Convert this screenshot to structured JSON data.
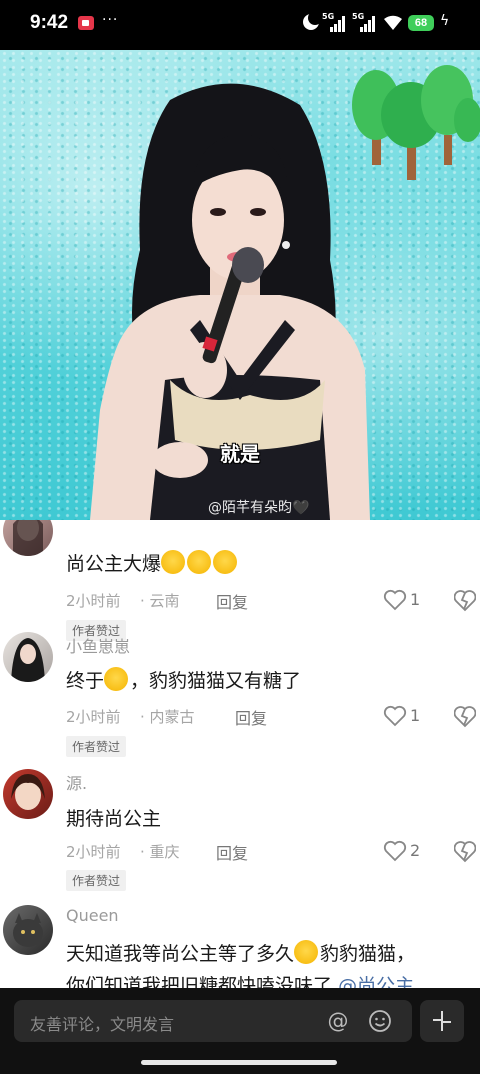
{
  "status_bar": {
    "time": "9:42",
    "dots": "···",
    "signal1_label": "5G",
    "signal2_label": "5G",
    "battery": "68"
  },
  "video": {
    "caption": "就是",
    "watermark": "@陌芊有朵昀🖤"
  },
  "comments": [
    {
      "username": "",
      "text": "尚公主大爆",
      "emoji": [
        "laugh",
        "laugh",
        "laugh"
      ],
      "time": "2小时前",
      "location": "云南",
      "reply": "回复",
      "likes": "1",
      "author_liked": "作者赞过"
    },
    {
      "username": "小鱼崽崽",
      "text_pre": "终于",
      "emoji": [
        "cry"
      ],
      "text_post": "，豹豹猫猫又有糖了",
      "time": "2小时前",
      "location": "内蒙古",
      "reply": "回复",
      "likes": "1",
      "author_liked": "作者赞过"
    },
    {
      "username": "源.",
      "text": "期待尚公主",
      "time": "2小时前",
      "location": "重庆",
      "reply": "回复",
      "likes": "2",
      "author_liked": "作者赞过"
    },
    {
      "username": "Queen",
      "text_pre": "天知道我等尚公主等了多久",
      "emoji": [
        "pleading"
      ],
      "text_post": "豹豹猫猫，",
      "line2": "你们知道我把旧糖都快嗑没味了",
      "mention": "@尚公主"
    }
  ],
  "input": {
    "placeholder": "友善评论，文明发言"
  },
  "icons": {
    "at": "at-icon",
    "emoji": "smile-icon",
    "expand": "expand-icon"
  },
  "colors": {
    "accent_battery": "#3fce5a",
    "mention": "#4a6fa5",
    "recording": "#e5364a"
  }
}
